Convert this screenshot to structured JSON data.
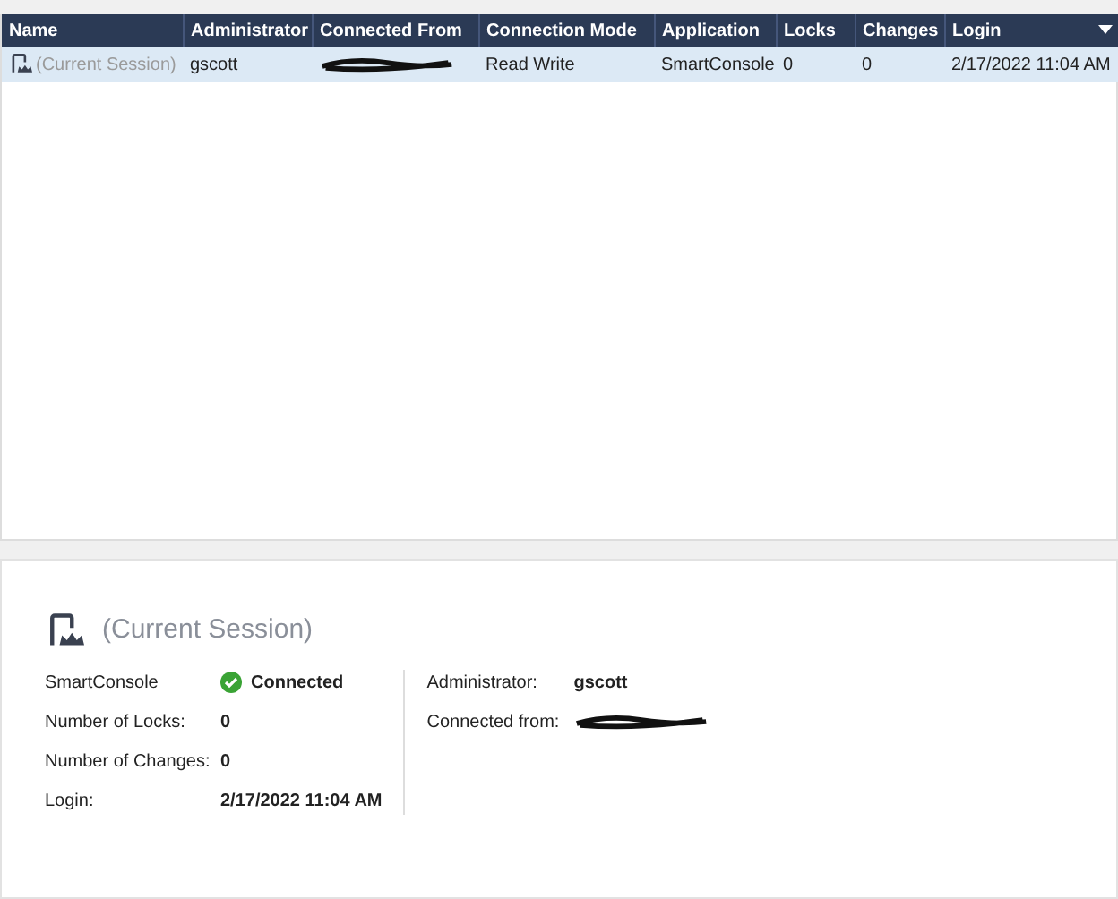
{
  "table": {
    "columns": [
      "Name",
      "Administrator",
      "Connected From",
      "Connection Mode",
      "Application",
      "Locks",
      "Changes",
      "Login"
    ],
    "rows": [
      {
        "selected": true,
        "cells": [
          {
            "text": "(Current Session)",
            "muted": true
          },
          {
            "text": "gscott"
          },
          {
            "redacted": true
          },
          {
            "text": "Read Write"
          },
          {
            "text": "SmartConsole"
          },
          {
            "text": "0"
          },
          {
            "text": "0"
          },
          {
            "text": "2/17/2022 11:04 AM"
          }
        ]
      }
    ]
  },
  "details": {
    "title": "(Current Session)",
    "left": [
      {
        "label": "SmartConsole",
        "value": "Connected",
        "connected": true
      },
      {
        "label": "Number of Locks:",
        "value": "0"
      },
      {
        "label": "Number of Changes:",
        "value": "0"
      },
      {
        "label": "Login:",
        "value": "2/17/2022 11:04 AM"
      }
    ],
    "right": [
      {
        "label": "Administrator:",
        "value": "gscott"
      },
      {
        "label": "Connected from:",
        "redacted": true
      }
    ]
  }
}
